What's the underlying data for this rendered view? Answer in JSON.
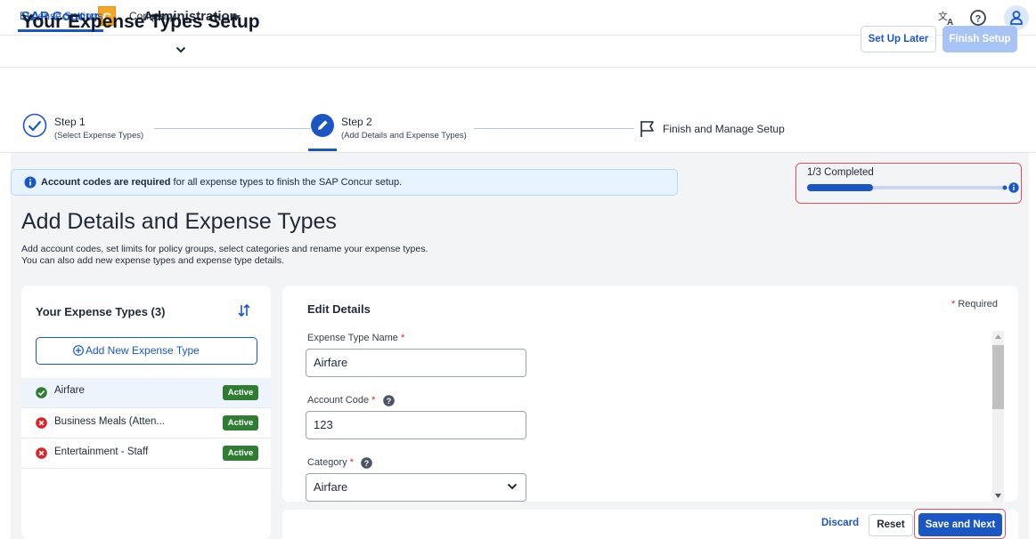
{
  "header": {
    "logo_text": "SAP Concur",
    "logo_mark": "C",
    "menu_label": "Administration",
    "icons": [
      "translate-icon",
      "help-icon",
      "user-icon"
    ]
  },
  "subnav": {
    "tabs": [
      {
        "label": "Expense Settings",
        "active": true
      },
      {
        "label": "Company",
        "active": false
      }
    ]
  },
  "setup": {
    "title": "Your Expense Types Setup",
    "steps": [
      {
        "label": "Step 1",
        "sub": "(Select Expense Types)",
        "state": "complete"
      },
      {
        "label": "Step 2",
        "sub": "(Add Details and Expense Types)",
        "state": "current"
      },
      {
        "label": "Finish and Manage Setup",
        "sub": "",
        "state": "pending"
      }
    ],
    "set_up_later": "Set Up Later",
    "finish_setup": "Finish Setup"
  },
  "alert": {
    "bold": "Account codes are required",
    "rest": " for all expense types to finish the SAP Concur setup."
  },
  "progress": {
    "label": "1/3 Completed",
    "fraction": 0.333
  },
  "page": {
    "heading": "Add Details and Expense Types",
    "desc_line1": "Add account codes, set limits for policy groups, select categories and rename your expense types.",
    "desc_line2": "You can also add new expense types and expense type details."
  },
  "expense_types": {
    "title": "Your Expense Types (3)",
    "add_label": "Add New Expense Type",
    "items": [
      {
        "name": "Airfare",
        "status": "Active",
        "valid": true,
        "selected": true
      },
      {
        "name": "Business Meals (Atten...",
        "status": "Active",
        "valid": false,
        "selected": false
      },
      {
        "name": "Entertainment - Staff",
        "status": "Active",
        "valid": false,
        "selected": false
      }
    ]
  },
  "details": {
    "title": "Edit Details",
    "required_note": "Required",
    "name_label": "Expense Type Name",
    "name_value": "Airfare",
    "account_label": "Account Code",
    "account_value": "123",
    "category_label": "Category",
    "category_value": "Airfare"
  },
  "footer": {
    "discard": "Discard",
    "reset": "Reset",
    "save_next": "Save and Next"
  },
  "colors": {
    "brand_blue": "#1a56c4",
    "success_green": "#2e7d32",
    "error_red": "#d8232a",
    "highlight_red": "#e74c5a"
  }
}
